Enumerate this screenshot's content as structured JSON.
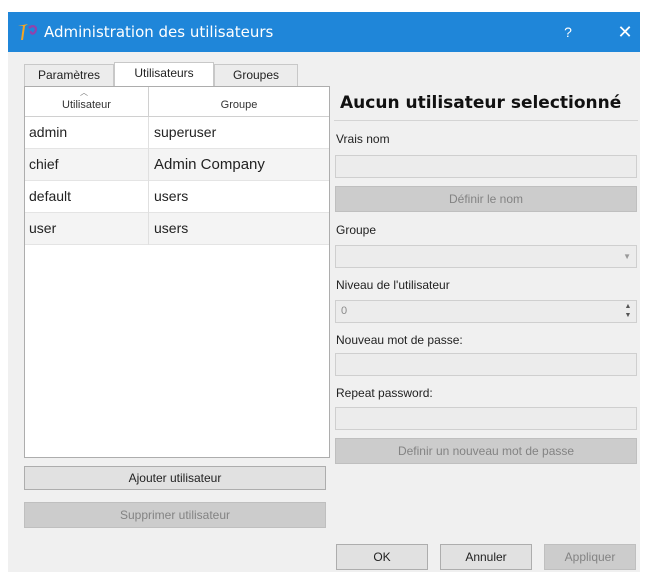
{
  "window": {
    "title": "Administration des utilisateurs",
    "app_icon": "tango-app-icon",
    "help_label": "?",
    "close_label": "✕",
    "accent_color": "#1f86d9"
  },
  "tabs": [
    {
      "label": "Paramètres",
      "active": false
    },
    {
      "label": "Utilisateurs",
      "active": true
    },
    {
      "label": "Groupes",
      "active": false
    }
  ],
  "table": {
    "columns": [
      "Utilisateur",
      "Groupe"
    ],
    "sort_indicator": "^",
    "rows": [
      {
        "user": "admin",
        "group": "superuser"
      },
      {
        "user": "chief",
        "group": "Admin Company"
      },
      {
        "user": "default",
        "group": "users"
      },
      {
        "user": "user",
        "group": "users"
      }
    ]
  },
  "actions": {
    "add_user": "Ajouter utilisateur",
    "delete_user": "Supprimer utilisateur"
  },
  "details": {
    "heading": "Aucun utilisateur selectionné",
    "real_name_label": "Vrais nom",
    "real_name_value": "",
    "set_name_button": "Définir le nom",
    "group_label": "Groupe",
    "group_value": "",
    "level_label": "Niveau de l'utilisateur",
    "level_value": "0",
    "new_password_label": "Nouveau mot de passe:",
    "new_password_value": "",
    "repeat_password_label": "Repeat password:",
    "repeat_password_value": "",
    "set_password_button": "Definir un nouveau mot de passe"
  },
  "footer": {
    "ok": "OK",
    "cancel": "Annuler",
    "apply": "Appliquer"
  }
}
